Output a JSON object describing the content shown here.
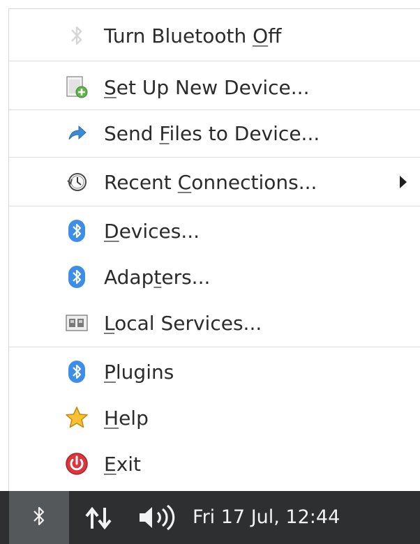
{
  "menu": {
    "items": [
      {
        "pre": "Turn Bluetooth ",
        "acc": "O",
        "post": "ff",
        "icon": "bluetooth-disabled-icon"
      },
      {
        "pre": "",
        "acc": "S",
        "post": "et Up New Device...",
        "icon": "new-device-icon"
      },
      {
        "pre": "Send ",
        "acc": "F",
        "post": "iles to Device...",
        "icon": "send-arrow-icon"
      },
      {
        "pre": "Recent ",
        "acc": "C",
        "post": "onnections...",
        "icon": "recent-clock-icon"
      },
      {
        "pre": "",
        "acc": "D",
        "post": "evices...",
        "icon": "bluetooth-icon"
      },
      {
        "pre": "Adap",
        "acc": "t",
        "post": "ers...",
        "icon": "bluetooth-icon"
      },
      {
        "pre": "",
        "acc": "L",
        "post": "ocal Services...",
        "icon": "local-services-icon"
      },
      {
        "pre": "",
        "acc": "P",
        "post": "lugins",
        "icon": "bluetooth-icon"
      },
      {
        "pre": "",
        "acc": "H",
        "post": "elp",
        "icon": "star-icon"
      },
      {
        "pre": "",
        "acc": "E",
        "post": "xit",
        "icon": "power-icon"
      }
    ]
  },
  "taskbar": {
    "clock": "Fri 17 Jul, 12:44",
    "icons": [
      "bluetooth-icon",
      "network-icon",
      "volume-icon"
    ]
  },
  "colors": {
    "bluetooth_blue": "#3d8ee8",
    "exit_red": "#d9363e",
    "taskbar_bg": "#2e2f30",
    "taskbar_active": "#55585b"
  }
}
